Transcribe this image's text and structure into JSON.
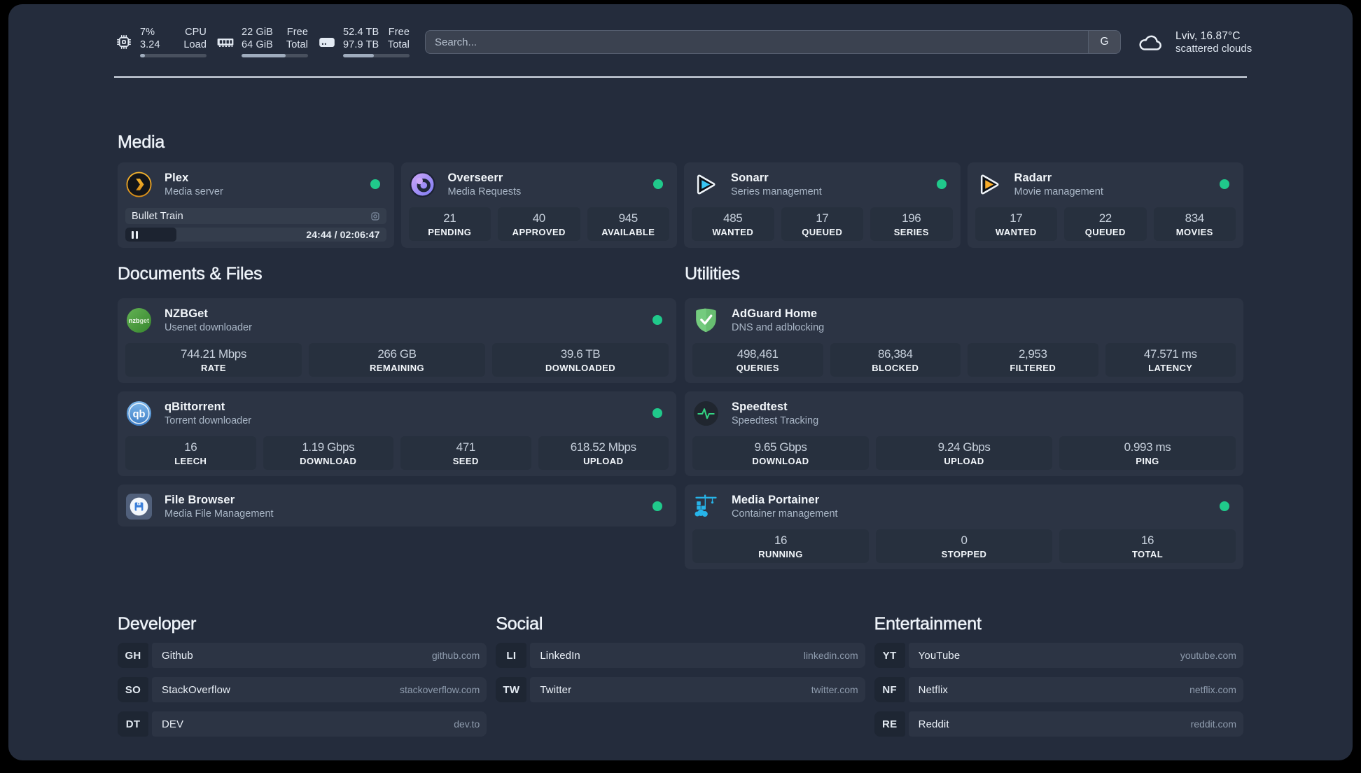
{
  "topbar": {
    "resources": [
      {
        "icon": "cpu-icon",
        "line1_left": "7%",
        "line1_right": "CPU",
        "line2_left": "3.24",
        "line2_right": "Load",
        "percent": 7
      },
      {
        "icon": "memory-icon",
        "line1_left": "22 GiB",
        "line1_right": "Free",
        "line2_left": "64 GiB",
        "line2_right": "Total",
        "percent": 66
      },
      {
        "icon": "disk-icon",
        "line1_left": "52.4 TB",
        "line1_right": "Free",
        "line2_left": "97.9 TB",
        "line2_right": "Total",
        "percent": 46
      }
    ],
    "search": {
      "placeholder": "Search...",
      "button_label": "G"
    },
    "weather": {
      "location": "Lviv, 16.87°C",
      "condition": "scattered clouds"
    }
  },
  "colors": {
    "status_online": "#21C97F",
    "background": "#212940",
    "card": "#2B3447"
  },
  "groups": {
    "media": {
      "title": "Media",
      "plex": {
        "name": "Plex",
        "desc": "Media server",
        "icon": "plex-icon",
        "online": true,
        "now_playing": {
          "title": "Bullet Train",
          "progress_percent": 19.5,
          "time": "24:44 / 02:06:47"
        }
      },
      "overseerr": {
        "name": "Overseerr",
        "desc": "Media Requests",
        "icon": "overseerr-icon",
        "online": true,
        "stats": [
          {
            "value": "21",
            "label": "PENDING"
          },
          {
            "value": "40",
            "label": "APPROVED"
          },
          {
            "value": "945",
            "label": "AVAILABLE"
          }
        ]
      },
      "sonarr": {
        "name": "Sonarr",
        "desc": "Series management",
        "icon": "sonarr-icon",
        "online": true,
        "stats": [
          {
            "value": "485",
            "label": "WANTED"
          },
          {
            "value": "17",
            "label": "QUEUED"
          },
          {
            "value": "196",
            "label": "SERIES"
          }
        ]
      },
      "radarr": {
        "name": "Radarr",
        "desc": "Movie management",
        "icon": "radarr-icon",
        "online": true,
        "stats": [
          {
            "value": "17",
            "label": "WANTED"
          },
          {
            "value": "22",
            "label": "QUEUED"
          },
          {
            "value": "834",
            "label": "MOVIES"
          }
        ]
      }
    },
    "documents": {
      "title": "Documents & Files",
      "nzbget": {
        "name": "NZBGet",
        "desc": "Usenet downloader",
        "icon": "nzbget-icon",
        "online": true,
        "stats": [
          {
            "value": "744.21 Mbps",
            "label": "RATE"
          },
          {
            "value": "266 GB",
            "label": "REMAINING"
          },
          {
            "value": "39.6 TB",
            "label": "DOWNLOADED"
          }
        ]
      },
      "qbittorrent": {
        "name": "qBittorrent",
        "desc": "Torrent downloader",
        "icon": "qbittorrent-icon",
        "online": true,
        "stats": [
          {
            "value": "16",
            "label": "LEECH"
          },
          {
            "value": "1.19 Gbps",
            "label": "DOWNLOAD"
          },
          {
            "value": "471",
            "label": "SEED"
          },
          {
            "value": "618.52 Mbps",
            "label": "UPLOAD"
          }
        ]
      },
      "filebrowser": {
        "name": "File Browser",
        "desc": "Media File Management",
        "icon": "filebrowser-icon",
        "online": true
      }
    },
    "utilities": {
      "title": "Utilities",
      "adguard": {
        "name": "AdGuard Home",
        "desc": "DNS and adblocking",
        "icon": "adguard-icon",
        "stats": [
          {
            "value": "498,461",
            "label": "QUERIES"
          },
          {
            "value": "86,384",
            "label": "BLOCKED"
          },
          {
            "value": "2,953",
            "label": "FILTERED"
          },
          {
            "value": "47.571 ms",
            "label": "LATENCY"
          }
        ]
      },
      "speedtest": {
        "name": "Speedtest",
        "desc": "Speedtest Tracking",
        "icon": "speedtest-icon",
        "stats": [
          {
            "value": "9.65 Gbps",
            "label": "DOWNLOAD"
          },
          {
            "value": "9.24 Gbps",
            "label": "UPLOAD"
          },
          {
            "value": "0.993 ms",
            "label": "PING"
          }
        ]
      },
      "portainer": {
        "name": "Media Portainer",
        "desc": "Container management",
        "icon": "portainer-icon",
        "online": true,
        "stats": [
          {
            "value": "16",
            "label": "RUNNING"
          },
          {
            "value": "0",
            "label": "STOPPED"
          },
          {
            "value": "16",
            "label": "TOTAL"
          }
        ]
      }
    }
  },
  "bookmarks": [
    {
      "title": "Developer",
      "items": [
        {
          "abbr": "GH",
          "name": "Github",
          "url": "github.com"
        },
        {
          "abbr": "SO",
          "name": "StackOverflow",
          "url": "stackoverflow.com"
        },
        {
          "abbr": "DT",
          "name": "DEV",
          "url": "dev.to"
        }
      ]
    },
    {
      "title": "Social",
      "items": [
        {
          "abbr": "LI",
          "name": "LinkedIn",
          "url": "linkedin.com"
        },
        {
          "abbr": "TW",
          "name": "Twitter",
          "url": "twitter.com"
        }
      ]
    },
    {
      "title": "Entertainment",
      "items": [
        {
          "abbr": "YT",
          "name": "YouTube",
          "url": "youtube.com"
        },
        {
          "abbr": "NF",
          "name": "Netflix",
          "url": "netflix.com"
        },
        {
          "abbr": "RE",
          "name": "Reddit",
          "url": "reddit.com"
        }
      ]
    }
  ]
}
